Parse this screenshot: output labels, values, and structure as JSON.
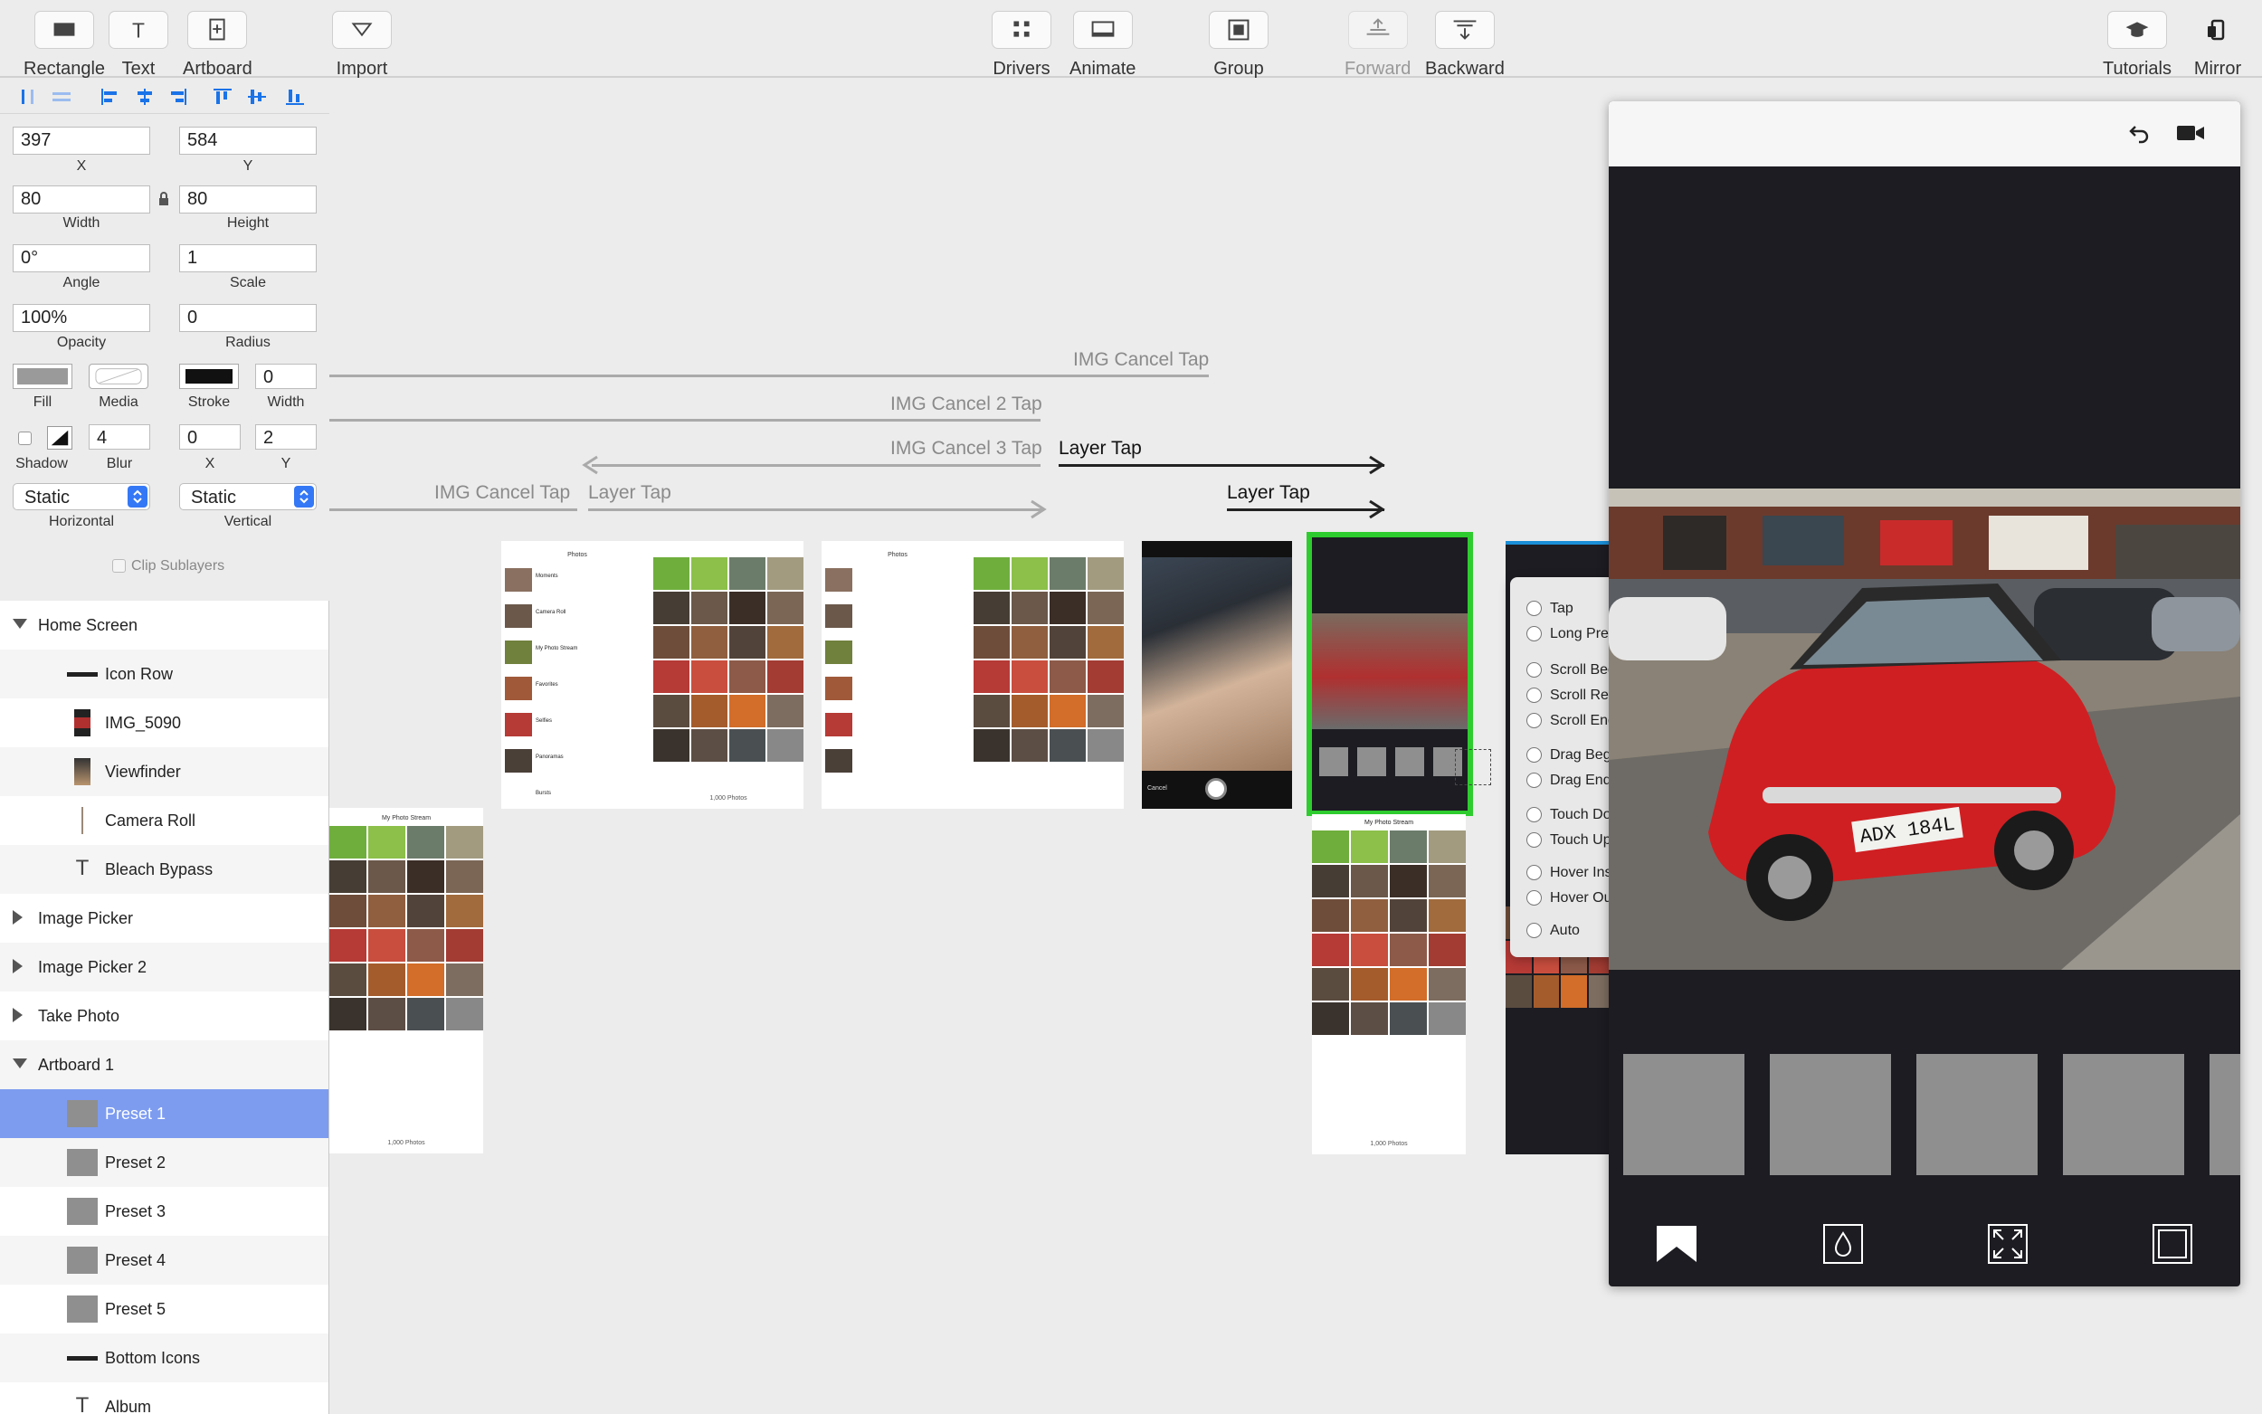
{
  "toolbar": {
    "rectangle": "Rectangle",
    "text": "Text",
    "artboard": "Artboard",
    "import": "Import",
    "drivers": "Drivers",
    "animate": "Animate",
    "group": "Group",
    "forward": "Forward",
    "backward": "Backward",
    "tutorials": "Tutorials",
    "mirror": "Mirror"
  },
  "inspector": {
    "x": "397",
    "x_label": "X",
    "y": "584",
    "y_label": "Y",
    "width": "80",
    "width_label": "Width",
    "height": "80",
    "height_label": "Height",
    "angle": "0°",
    "angle_label": "Angle",
    "scale": "1",
    "scale_label": "Scale",
    "opacity": "100%",
    "opacity_label": "Opacity",
    "radius": "0",
    "radius_label": "Radius",
    "fill_label": "Fill",
    "media_label": "Media",
    "stroke_label": "Stroke",
    "stroke_width": "0",
    "stroke_width_label": "Width",
    "shadow_label": "Shadow",
    "blur": "4",
    "blur_label": "Blur",
    "shadow_x": "0",
    "shadow_x_label": "X",
    "shadow_y": "2",
    "shadow_y_label": "Y",
    "horizontal": "Static",
    "horizontal_label": "Horizontal",
    "vertical": "Static",
    "vertical_label": "Vertical",
    "clip_sublayers": "Clip Sublayers"
  },
  "layers": [
    {
      "label": "Home Screen",
      "type": "group-open"
    },
    {
      "label": "Icon Row",
      "type": "child"
    },
    {
      "label": "IMG_5090",
      "type": "child"
    },
    {
      "label": "Viewfinder",
      "type": "child"
    },
    {
      "label": "Camera Roll",
      "type": "child"
    },
    {
      "label": "Bleach Bypass",
      "type": "text"
    },
    {
      "label": "Image Picker",
      "type": "group-closed"
    },
    {
      "label": "Image Picker 2",
      "type": "group-closed"
    },
    {
      "label": "Take Photo",
      "type": "group-closed"
    },
    {
      "label": "Artboard 1",
      "type": "group-open"
    },
    {
      "label": "Preset 1",
      "type": "child",
      "selected": true
    },
    {
      "label": "Preset 2",
      "type": "child"
    },
    {
      "label": "Preset 3",
      "type": "child"
    },
    {
      "label": "Preset 4",
      "type": "child"
    },
    {
      "label": "Preset 5",
      "type": "child"
    },
    {
      "label": "Bottom Icons",
      "type": "child"
    },
    {
      "label": "Album",
      "type": "text"
    }
  ],
  "connections": {
    "c1": "IMG Cancel Tap",
    "c2": "IMG Cancel 2 Tap",
    "c3": "IMG Cancel 3 Tap",
    "c4": "Layer Tap",
    "c5": "IMG Cancel Tap",
    "c6": "Layer Tap",
    "c7": "Layer Tap"
  },
  "thumbs": {
    "photos_title": "Photos",
    "photo_stream": "My Photo Stream",
    "moments": "Moments",
    "camera_roll": "Camera Roll",
    "favorites": "Favorites",
    "selfies": "Selfies",
    "panoramas": "Panoramas",
    "bursts": "Bursts",
    "cancel": "Cancel",
    "count": "1,000 Photos"
  },
  "trigger_menu": [
    "Tap",
    "Long Press",
    "Scroll Begin",
    "Scroll Release",
    "Scroll End",
    "Drag Begin",
    "Drag End",
    "Touch Down",
    "Touch Up",
    "Hover Inside",
    "Hover Outside",
    "Auto"
  ],
  "preview": {
    "plate": "ADX 184L",
    "icons": [
      "undo-icon",
      "video-camera-icon",
      "bookmark-icon",
      "droplet-icon",
      "crop-expand-icon",
      "square-frame-icon"
    ]
  },
  "colors": {
    "selection": "#7d9cf0",
    "active_frame": "#2ecc2e",
    "accent_blue": "#1a73e8",
    "preview_bg": "#1c1c22"
  }
}
